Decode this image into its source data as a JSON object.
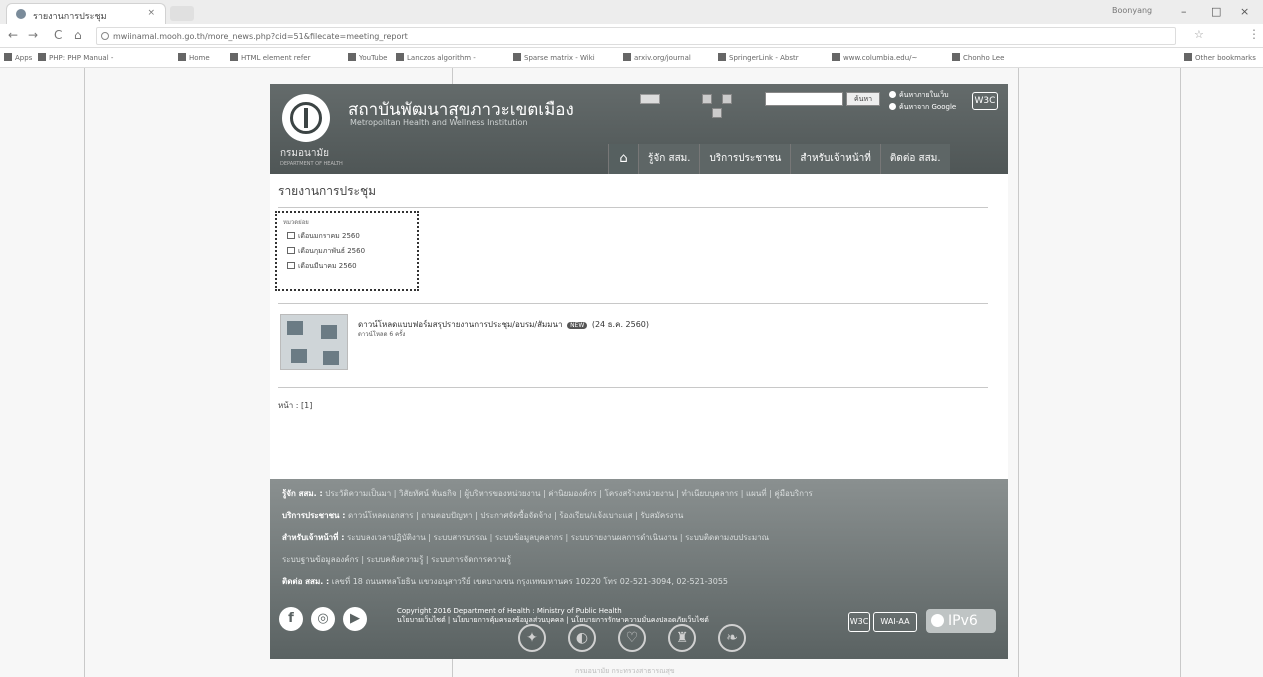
{
  "browser": {
    "tab_title": "รายงานการประชุม",
    "tab_close": "×",
    "profile": "Boonyang",
    "minimize": "–",
    "maximize": "□",
    "close": "×",
    "back": "←",
    "forward": "→",
    "reload": "C",
    "home": "⌂",
    "url": "mwiinamal.mooh.go.th/more_news.php?cid=51&filecate=meeting_report",
    "star": "☆",
    "menu": "⋮",
    "bookmarks": [
      "Apps",
      "PHP: PHP Manual -",
      "Home",
      "HTML element refer",
      "YouTube",
      "Lanczos algorithm -",
      "Sparse matrix - Wiki",
      "arxiv.org/journal",
      "SpringerLink - Abstr",
      "www.columbia.edu/~",
      "Chonho Lee"
    ],
    "other_bookmarks": "Other bookmarks"
  },
  "site": {
    "title": "สถาบันพัฒนาสุขภาวะเขตเมือง",
    "subtitle": "Metropolitan Health and Wellness Institution",
    "dept": "กรมอนามัย",
    "dept_en": "DEPARTMENT OF HEALTH",
    "search_btn": "ค้นหา",
    "radio1": "ค้นหาภายในเว็บ",
    "radio2": "ค้นหาจาก Google",
    "w3c": "W3C",
    "nav": [
      "รู้จัก สสม.",
      "บริการประชาชน",
      "สำหรับเจ้าหน้าที่",
      "ติดต่อ สสม."
    ]
  },
  "content": {
    "page_title": "รายงานการประชุม",
    "category_label": "หมวดย่อย",
    "categories": [
      "เดือนมกราคม 2560",
      "เดือนกุมภาพันธ์ 2560",
      "เดือนมีนาคม 2560"
    ],
    "doc_title": "ดาวน์โหลดแบบฟอร์มสรุปรายงานการประชุม/อบรม/สัมมนา",
    "doc_badge": "NEW",
    "doc_date": "(24 ธ.ค. 2560)",
    "doc_downloads": "ดาวน์โหลด 6 ครั้ง",
    "pager": "หน้า : [1]"
  },
  "footer": {
    "row1_label": "รู้จัก สสม. :",
    "row1_links": "ประวัติความเป็นมา | วิสัยทัศน์ พันธกิจ | ผู้บริหารของหน่วยงาน | ค่านิยมองค์กร | โครงสร้างหน่วยงาน | ทำเนียบบุคลากร | แผนที่ | คู่มือบริการ",
    "row2_label": "บริการประชาชน :",
    "row2_links": "ดาวน์โหลดเอกสาร | ถามตอบปัญหา | ประกาศจัดซื้อจัดจ้าง | ร้องเรียน/แจ้งเบาะแส | รับสมัครงาน",
    "row3_label": "สำหรับเจ้าหน้าที่ :",
    "row3_links": "ระบบลงเวลาปฏิบัติงาน | ระบบสารบรรณ | ระบบข้อมูลบุคลากร | ระบบรายงานผลการดำเนินงาน | ระบบติดตามงบประมาณ",
    "row3b_links": "ระบบฐานข้อมูลองค์กร | ระบบคลังความรู้ | ระบบการจัดการความรู้",
    "row4_label": "ติดต่อ สสม. :",
    "row4_text": "เลขที่ 18 ถนนพหลโยธิน แขวงอนุสาวรีย์ เขตบางเขน กรุงเทพมหานคร 10220 โทร 02-521-3094, 02-521-3055",
    "copyright": "Copyright 2016 Department of Health : Ministry of Public Health",
    "policy": "นโยบายเว็บไซต์ | นโยบายการคุ้มครองข้อมูลส่วนบุคคล | นโยบายการรักษาความมั่นคงปลอดภัยเว็บไซต์",
    "w3c": "W3C",
    "wai": "WAI-AA",
    "ipv6": "IPv6"
  },
  "bottom": {
    "text": "กรมอนามัย กระทรวงสาธารณสุข"
  }
}
